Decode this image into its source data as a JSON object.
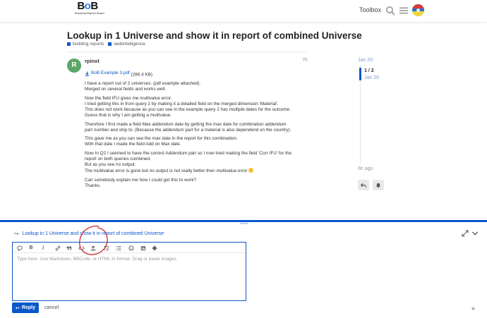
{
  "header": {
    "logo_text": "BoB",
    "logo_subtitle": "BusinessObjects Board",
    "toolbox_label": "Toolbox"
  },
  "topic": {
    "title": "Lookup in 1 Universe and show it in report of combined Universe",
    "tags": [
      "building reports",
      "webintelligence"
    ]
  },
  "post": {
    "avatar_letter": "R",
    "username": "rpinxt",
    "time": "7h",
    "attachment_name": "BoB Example 3.pdf",
    "attachment_size": "(286.4 KB)",
    "paragraphs": [
      [
        "I have a report out of 2 universes. (pdf example attached).",
        "Merged on several fields and works well."
      ],
      [
        "Now the field IFU gives me multivalue error.",
        "I tried getting this in from query 2 by making it a detailed field on the merged dimension 'Material'.",
        "This does not work because as you can see in the example query 2 has multiple dates for the outcome.",
        "Guess that is why I am getting a multivalue."
      ],
      [
        "Therefore I first made a field Max addendum date by getting the max date for combination addendum",
        "part number and ship to. (Because the addendum part for a material is also dependend on the country)."
      ],
      [
        "This gave me as you can see the max date in the report for this combination.",
        "With that date I made the field Add on Max date."
      ],
      [
        "Now In Q2 I seemed to have the correct Addendum part so I now tried making the field 'Corr IFU' for the",
        "report on both queries combined.",
        "But as you see no output.",
        "The multivalue error is gone but no output is not really better then multivalue error"
      ],
      [
        "Can somebody explain me how I could get this to work?",
        "Thanks."
      ]
    ]
  },
  "timeline": {
    "top_date": "Jan 20",
    "position": "1 / 2",
    "current_date": "Jan 20",
    "bottom_label": "6h ago"
  },
  "composer": {
    "reply_to_title": "Lookup in 1 Universe and show it in report of combined Universe",
    "placeholder": "Type here. Use Markdown, BBCode, or HTML to format. Drag or paste images.",
    "reply_label": "Reply",
    "cancel_label": "cancel",
    "toolbar_icons": [
      "quote-icon",
      "bold-icon",
      "italic-icon",
      "link-icon",
      "blockquote-icon",
      "code-icon",
      "upload-icon",
      "bullet-list-icon",
      "numbered-list-icon",
      "emoji-icon",
      "date-icon",
      "gear-icon"
    ]
  },
  "colors": {
    "accent": "#0a58ca",
    "avatar_green": "#5aa865",
    "annotation_red": "#d0262a"
  }
}
